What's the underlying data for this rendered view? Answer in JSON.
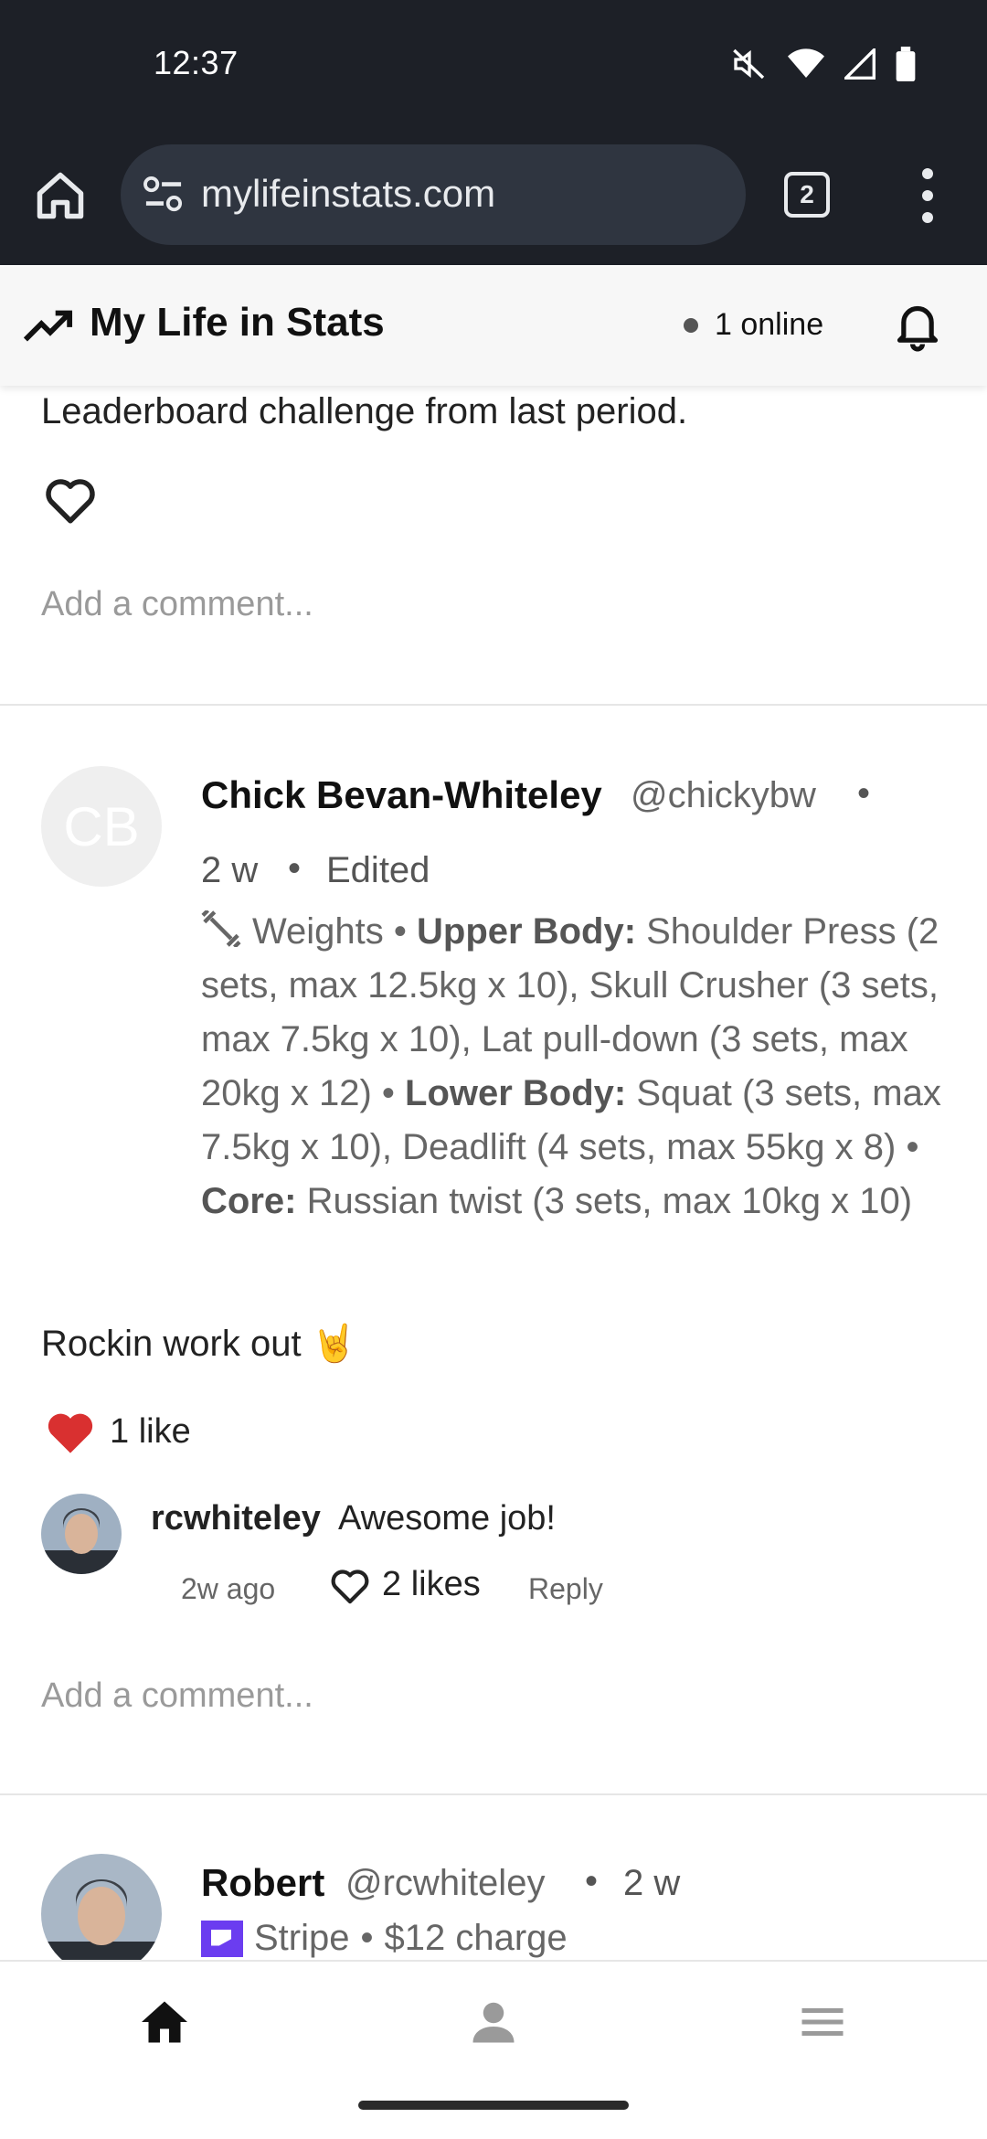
{
  "status_bar": {
    "time": "12:37"
  },
  "browser": {
    "url": "mylifeinstats.com",
    "tab_count": "2"
  },
  "app_header": {
    "title": "My Life in Stats",
    "online": "1 online"
  },
  "feed": {
    "previous_post": {
      "text": "Leaderboard challenge from last period.",
      "add_comment_placeholder": "Add a comment..."
    },
    "post": {
      "avatar_initials": "CB",
      "author_name": "Chick Bevan-Whiteley",
      "author_handle": "@chickybw",
      "age": "2 w",
      "edited": "Edited",
      "activity": "Weights",
      "workout": [
        {
          "group": "Upper Body:",
          "text": " Shoulder Press (2 sets, max 12.5kg x 10), Skull Crusher (3 sets, max 7.5kg x 10), Lat pull-down (3 sets, max 20kg x 12)"
        },
        {
          "group": "Lower Body:",
          "text": " Squat (3 sets, max 7.5kg x 10), Deadlift (4 sets, max 55kg x 8)"
        },
        {
          "group": "Core:",
          "text": " Russian twist (3 sets, max 10kg x 10)"
        }
      ],
      "body": "Rockin work out 🤘",
      "likes": "1 like",
      "comment": {
        "user": "rcwhiteley",
        "text": "Awesome job!",
        "time": "2w ago",
        "likes": "2 likes",
        "reply": "Reply"
      },
      "add_comment_placeholder": "Add a comment..."
    },
    "next_post": {
      "author_name": "Robert",
      "author_handle": "@rcwhiteley",
      "age": "2 w",
      "source": "Stripe",
      "summary": "$12 charge"
    }
  },
  "bottom_nav": [
    "home-icon",
    "profile-icon",
    "menu-icon"
  ]
}
